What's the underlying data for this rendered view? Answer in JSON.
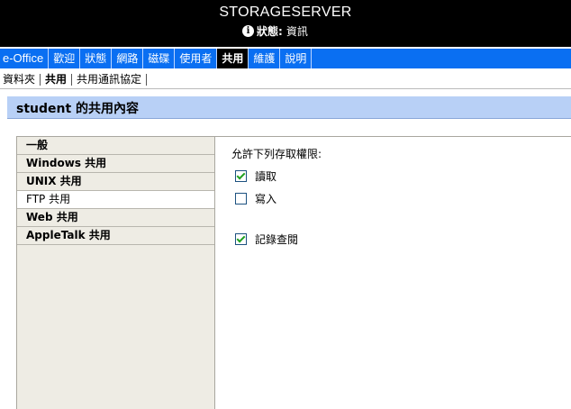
{
  "header": {
    "server_name": "STORAGESERVER",
    "status_label": "狀態:",
    "status_value": "資訊"
  },
  "main_nav": {
    "tabs": [
      "e-Office",
      "歡迎",
      "狀態",
      "網路",
      "磁碟",
      "使用者",
      "共用",
      "維護",
      "說明"
    ],
    "active_index": 6
  },
  "sub_nav": {
    "tabs": [
      "資料夾",
      "共用",
      "共用通訊協定"
    ],
    "active_index": 1
  },
  "page_title": "student 的共用內容",
  "left_menu": {
    "items": [
      "一般",
      "Windows 共用",
      "UNIX 共用",
      "FTP 共用",
      "Web 共用",
      "AppleTalk 共用"
    ],
    "active_index": 3
  },
  "permissions": {
    "title": "允許下列存取權限:",
    "read_label": "讀取",
    "read_checked": true,
    "write_label": "寫入",
    "write_checked": false,
    "log_label": "記錄查閱",
    "log_checked": true
  },
  "colors": {
    "header_bg": "#000000",
    "nav_bg": "#0a6ff2",
    "title_bar_bg": "#b8d0f6",
    "panel_bg": "#eeece4"
  }
}
